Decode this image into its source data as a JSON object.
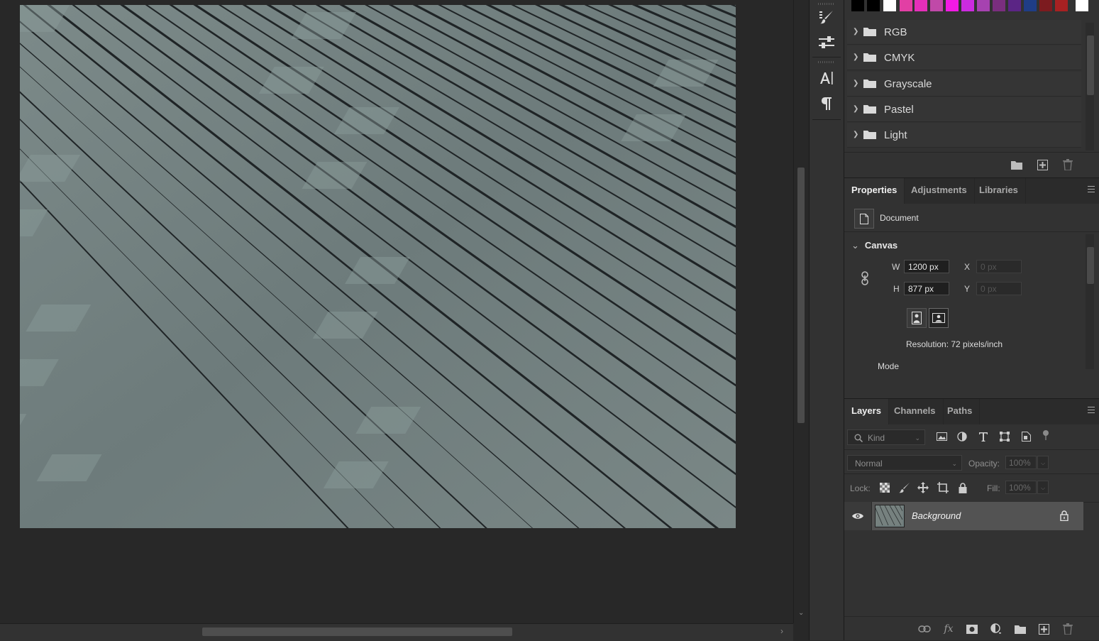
{
  "swatches": {
    "colors": [
      "#000000",
      "#000000",
      "#ffffff",
      "#e23fa4",
      "#e52fb9",
      "#c049a8",
      "#f21ae4",
      "#cc2be0",
      "#a642b0",
      "#7a2e7e",
      "#5b2585",
      "#1f3d86",
      "#7c1b1f",
      "#a72122",
      "#ffffff"
    ],
    "groups": [
      {
        "label": "RGB"
      },
      {
        "label": "CMYK"
      },
      {
        "label": "Grayscale"
      },
      {
        "label": "Pastel"
      },
      {
        "label": "Light"
      }
    ]
  },
  "properties": {
    "tabs": [
      "Properties",
      "Adjustments",
      "Libraries"
    ],
    "document_label": "Document",
    "canvas_header": "Canvas",
    "w_label": "W",
    "w_value": "1200 px",
    "h_label": "H",
    "h_value": "877 px",
    "x_label": "X",
    "x_value": "0 px",
    "y_label": "Y",
    "y_value": "0 px",
    "resolution": "Resolution: 72 pixels/inch",
    "mode_label": "Mode"
  },
  "layers": {
    "tabs": [
      "Layers",
      "Channels",
      "Paths"
    ],
    "filter_placeholder": "Kind",
    "blend_mode": "Normal",
    "opacity_label": "Opacity:",
    "opacity_value": "100%",
    "lock_label": "Lock:",
    "fill_label": "Fill:",
    "fill_value": "100%",
    "items": [
      {
        "name": "Background",
        "visible": true,
        "locked": true
      }
    ]
  },
  "tools": [
    "history-brush-icon",
    "adjust-sliders-icon",
    "character-icon",
    "paragraph-icon"
  ]
}
